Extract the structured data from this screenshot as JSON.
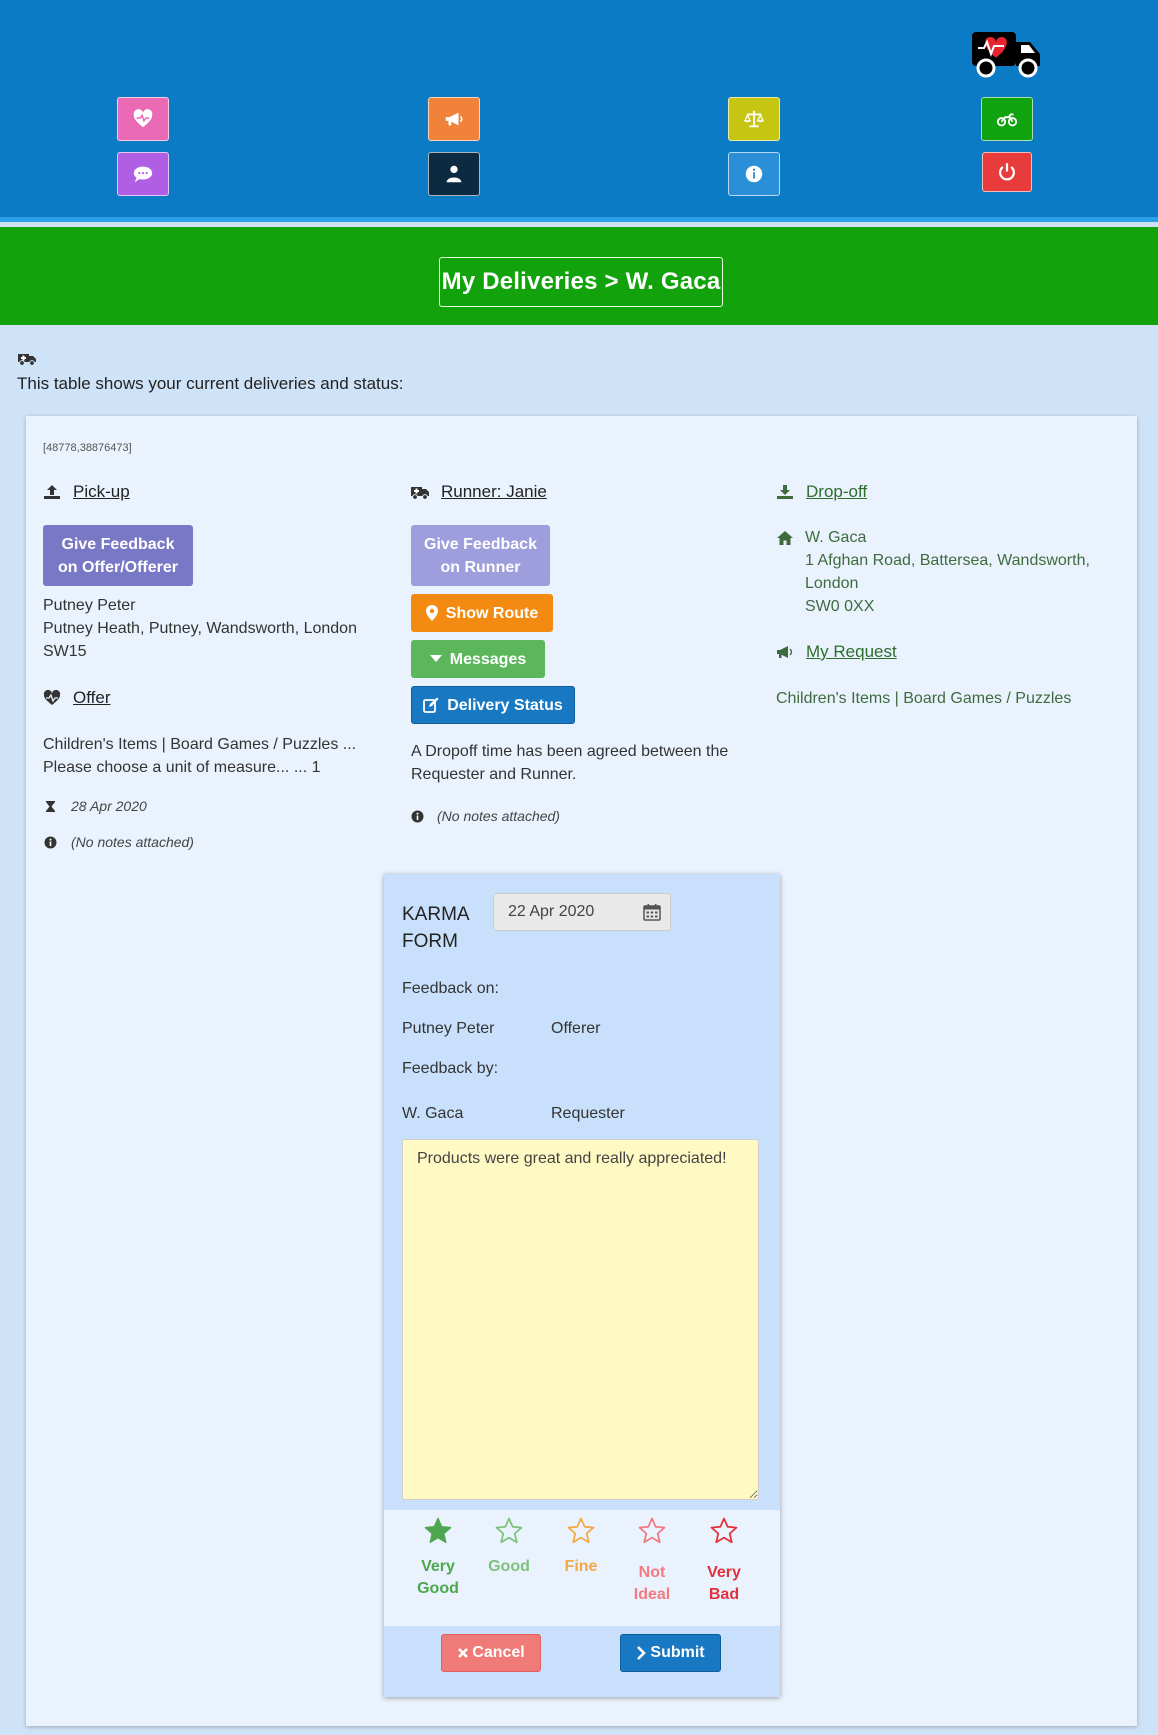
{
  "header": {
    "logo": "ambulance-heart-truck",
    "nav": [
      {
        "name": "heart",
        "color": "#ea6ab5"
      },
      {
        "name": "megaphone",
        "color": "#f0823a"
      },
      {
        "name": "balance-scale",
        "color": "#c5c512"
      },
      {
        "name": "motorcycle",
        "color": "#0fa30f"
      },
      {
        "name": "comment",
        "color": "#b05fe5"
      },
      {
        "name": "user",
        "color": "#0d2b40"
      },
      {
        "name": "info",
        "color": "#2a8fd6"
      },
      {
        "name": "power",
        "color": "#e83c3c"
      }
    ]
  },
  "title": "My Deliveries > W. Gaca",
  "intro": "This table shows your current deliveries and status:",
  "delivery": {
    "id": "[48778,38876473]",
    "pickup": {
      "heading": "Pick-up",
      "feedback_button": [
        "Give Feedback",
        "on Offer/Offerer"
      ],
      "name": "Putney Peter",
      "address": "Putney Heath, Putney, Wandsworth, London",
      "postcode": "SW15"
    },
    "offer": {
      "heading": "Offer",
      "line1": "Children's Items | Board Games / Puzzles ...",
      "line2": "Please choose a unit of measure... ... 1",
      "date": "28 Apr 2020",
      "notes": "(No notes attached)"
    },
    "runner": {
      "heading": "Runner: Janie",
      "feedback_button": [
        "Give Feedback",
        "on Runner"
      ],
      "show_route": "Show Route",
      "messages": "Messages",
      "delivery_status": "Delivery Status",
      "status_line1": "A Dropoff time has been agreed between the",
      "status_line2": "Requester and Runner.",
      "notes": "(No notes attached)"
    },
    "dropoff": {
      "heading": "Drop-off",
      "name": "W. Gaca",
      "address1": "1 Afghan Road, Battersea, Wandsworth,",
      "address2": "London",
      "postcode": "SW0 0XX"
    },
    "request": {
      "heading": "My Request",
      "items": "Children's Items | Board Games / Puzzles"
    }
  },
  "karma": {
    "title_line1": "KARMA",
    "title_line2": "FORM",
    "date": "22 Apr 2020",
    "feedback_on_label": "Feedback on:",
    "on_name": "Putney Peter",
    "on_role": "Offerer",
    "feedback_by_label": "Feedback by:",
    "by_name": "W. Gaca",
    "by_role": "Requester",
    "comment": "Products were great and really appreciated!",
    "selected_rating": "Very Good",
    "ratings": [
      {
        "l1": "Very",
        "l2": "Good",
        "color": "#4ea64e",
        "filled": true
      },
      {
        "l1": "Good",
        "l2": "",
        "color": "#7cc27c",
        "filled": false
      },
      {
        "l1": "Fine",
        "l2": "",
        "color": "#f5a742",
        "filled": false
      },
      {
        "l1": "Not",
        "l2": "Ideal",
        "color": "#f27a80",
        "filled": false
      },
      {
        "l1": "Very",
        "l2": "Bad",
        "color": "#e0313c",
        "filled": false
      }
    ],
    "cancel": "Cancel",
    "submit": "Submit"
  }
}
